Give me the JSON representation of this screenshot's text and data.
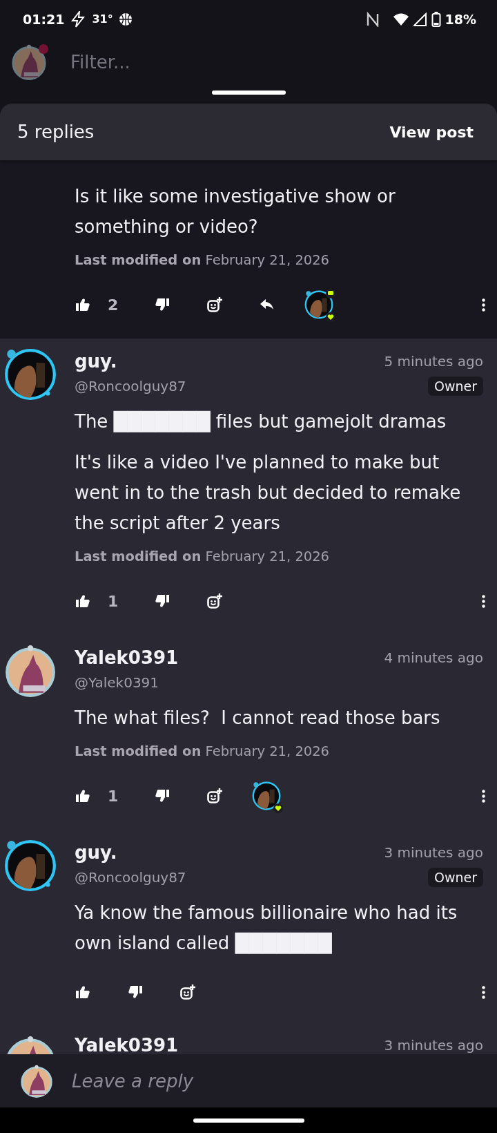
{
  "status_bar": {
    "time": "01:21",
    "temperature": "31°",
    "battery": "18%"
  },
  "top_bar": {
    "filter_placeholder": "Filter...",
    "has_notification": true
  },
  "sheet": {
    "title": "5 replies",
    "view_post": "View post"
  },
  "comments": [
    {
      "kind": "partial",
      "highlighted": true,
      "paragraphs": [
        "Is it like some investigative show or something or video?"
      ],
      "modified": "**Last modified on** February 21, 2026",
      "likes": "2",
      "can_reply": true,
      "reactions": [
        {
          "kind": "guy",
          "badges": [
            {
              "kind": "comment"
            },
            {
              "kind": "heart"
            }
          ]
        }
      ]
    },
    {
      "kind": "full",
      "highlighted": false,
      "avatar": {
        "kind": "guy"
      },
      "name": "guy.",
      "time": "5 minutes ago",
      "handle": "@Roncoolguy87",
      "badge": "Owner",
      "paragraphs": [
        "The ███████ files but gamejolt dramas",
        "It's like a video I've planned to make but went in to the trash but decided to remake the script after 2 years"
      ],
      "modified": "**Last modified on** February 21, 2026",
      "likes": "1",
      "can_reply": false
    },
    {
      "kind": "full",
      "highlighted": false,
      "avatar": {
        "kind": "yalek"
      },
      "name": "Yalek0391",
      "time": "4 minutes ago",
      "handle": "@Yalek0391",
      "paragraphs": [
        "The what files?  I cannot read those bars"
      ],
      "modified": "**Last modified on** February 21, 2026",
      "likes": "1",
      "can_reply": false,
      "reactions": [
        {
          "kind": "guy",
          "badges": [
            {
              "kind": "heart"
            }
          ]
        }
      ]
    },
    {
      "kind": "full",
      "highlighted": false,
      "avatar": {
        "kind": "guy"
      },
      "name": "guy.",
      "time": "3 minutes ago",
      "handle": "@Roncoolguy87",
      "badge": "Owner",
      "paragraphs": [
        "Ya know the famous billionaire who had its own island called ███████"
      ],
      "can_reply": false
    },
    {
      "kind": "cut",
      "highlighted": false,
      "avatar": {
        "kind": "yalek"
      },
      "name": "Yalek0391",
      "time": "3 minutes ago"
    }
  ],
  "reply_bar": {
    "placeholder": "Leave a reply"
  }
}
